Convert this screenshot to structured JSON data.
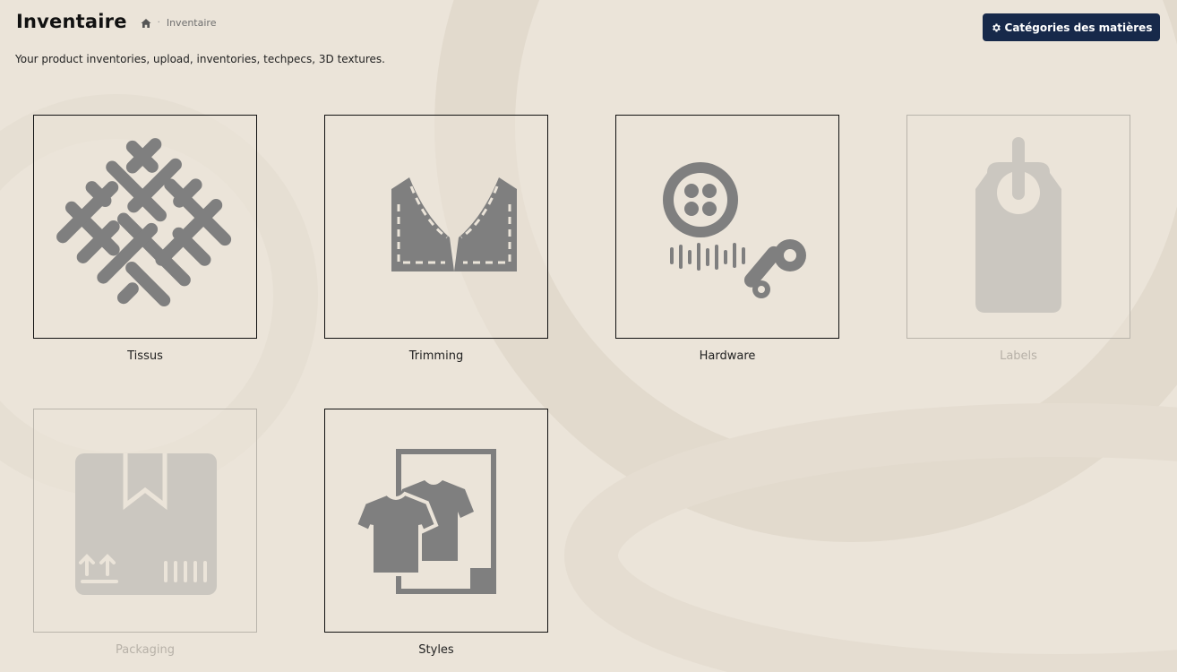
{
  "header": {
    "title": "Inventaire",
    "breadcrumb": {
      "home_icon": "home-icon",
      "separator": "·",
      "current": "Inventaire"
    },
    "subtitle": "Your product inventories, upload, inventories, techpecs, 3D textures.",
    "action_button": {
      "label": "Catégories des matières",
      "icon": "gear-icon"
    }
  },
  "tiles": [
    {
      "label": "Tissus",
      "icon": "woven-fabric-icon",
      "enabled": true
    },
    {
      "label": "Trimming",
      "icon": "garment-pattern-icon",
      "enabled": true
    },
    {
      "label": "Hardware",
      "icon": "button-zipper-icon",
      "enabled": true
    },
    {
      "label": "Labels",
      "icon": "hang-tag-icon",
      "enabled": false
    },
    {
      "label": "Packaging",
      "icon": "package-box-icon",
      "enabled": false
    },
    {
      "label": "Styles",
      "icon": "tshirt-styles-icon",
      "enabled": true
    }
  ],
  "colors": {
    "background": "#ebe4d9",
    "button": "#17294a",
    "icon": "#7f7f7f",
    "icon_disabled": "#cbc7c0"
  }
}
